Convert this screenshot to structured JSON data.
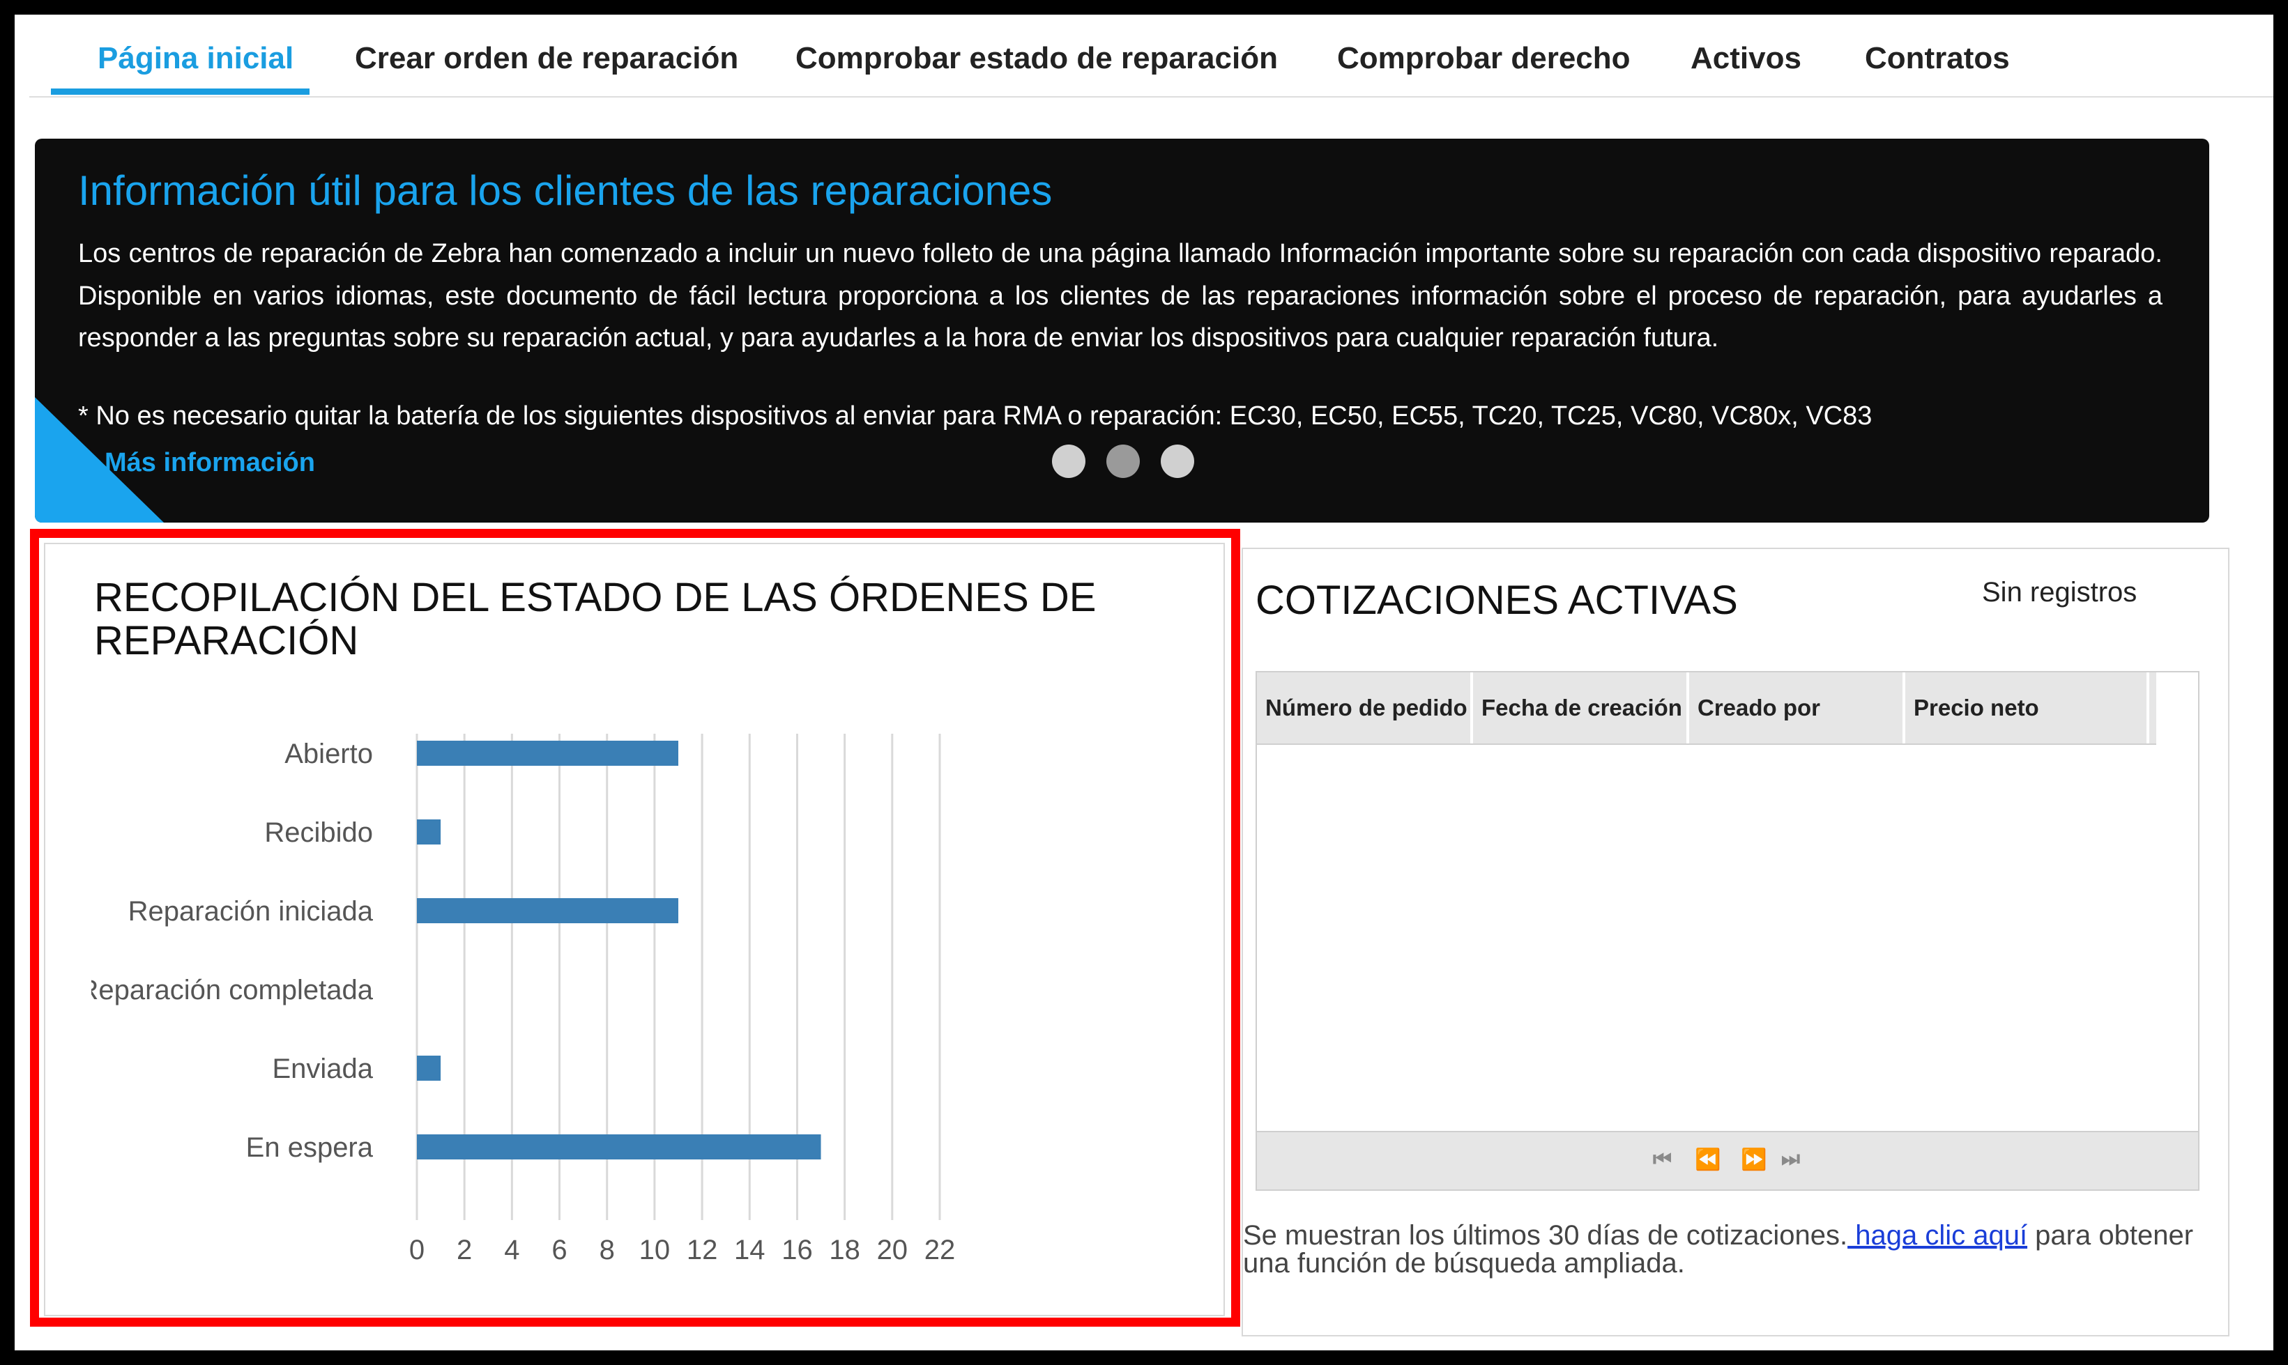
{
  "nav": {
    "tabs": [
      {
        "label": "Página inicial",
        "active": true
      },
      {
        "label": "Crear orden de reparación",
        "active": false
      },
      {
        "label": "Comprobar estado de reparación",
        "active": false
      },
      {
        "label": "Comprobar derecho",
        "active": false
      },
      {
        "label": "Activos",
        "active": false
      },
      {
        "label": "Contratos",
        "active": false
      }
    ]
  },
  "banner": {
    "title": "Información útil para los clientes de las reparaciones",
    "paragraph": "Los centros de reparación de Zebra han comenzado a incluir un nuevo folleto de una página llamado Información importante sobre su reparación con cada dispositivo reparado. Disponible en varios idiomas, este documento de fácil lectura proporciona a los clientes de las reparaciones información sobre el proceso de reparación, para ayudarles a responder a las preguntas sobre su reparación actual, y para ayudarles a la hora de enviar los dispositivos para cualquier reparación futura.",
    "note": "* No es necesario quitar la batería de los siguientes dispositivos al enviar para RMA o reparación: EC30, EC50, EC55, TC20, TC25, VC80, VC80x, VC83",
    "link": "Más información",
    "carousel_dot_colors": [
      "#d0d0d0",
      "#9a9a9a",
      "#d0d0d0"
    ]
  },
  "status_card": {
    "title": "RECOPILACIÓN DEL ESTADO DE LAS ÓRDENES DE REPARACIÓN"
  },
  "chart_data": {
    "type": "bar",
    "orientation": "horizontal",
    "categories": [
      "Abierto",
      "Recibido",
      "Reparación iniciada",
      "Reparación completada",
      "Enviada",
      "En espera"
    ],
    "values": [
      11,
      1,
      11,
      0,
      1,
      17
    ],
    "xlim": [
      0,
      22
    ],
    "xticks": [
      "0",
      "2",
      "4",
      "6",
      "8",
      "10",
      "12",
      "14",
      "16",
      "18",
      "20",
      "22"
    ],
    "grid": true,
    "bar_color": "#3a7fb5"
  },
  "quotes": {
    "title": "COTIZACIONES ACTIVAS",
    "status": "Sin registros",
    "columns": [
      "Número de pedido",
      "Fecha de creación",
      "Creado por",
      "Precio neto"
    ],
    "pager": [
      "⏮",
      "⏪",
      "⏩",
      "⏭"
    ],
    "footer_before": "Se muestran los últimos 30 días de cotizaciones.",
    "footer_link": " haga clic aquí",
    "footer_after": " para obtener una función de búsqueda ampliada."
  }
}
